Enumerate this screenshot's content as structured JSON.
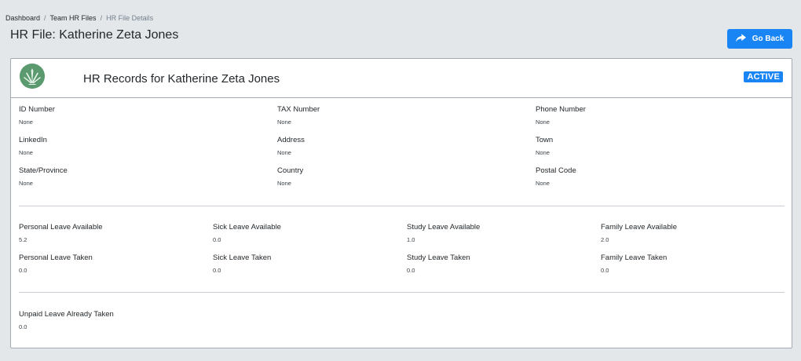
{
  "breadcrumb": {
    "items": [
      "Dashboard",
      "Team HR Files"
    ],
    "current": "HR File Details",
    "separator": "/"
  },
  "page_title": "HR File: Katherine Zeta Jones",
  "go_back_label": "Go Back",
  "card": {
    "title": "HR Records for Katherine Zeta Jones",
    "status": "ACTIVE",
    "colors": {
      "accent": "#1985f5",
      "logo_bg": "#5a9a6e"
    },
    "details": [
      {
        "label": "ID Number",
        "value": "None"
      },
      {
        "label": "TAX Number",
        "value": "None"
      },
      {
        "label": "Phone Number",
        "value": "None"
      },
      {
        "label": "LinkedIn",
        "value": "None"
      },
      {
        "label": "Address",
        "value": "None"
      },
      {
        "label": "Town",
        "value": "None"
      },
      {
        "label": "State/Province",
        "value": "None"
      },
      {
        "label": "Country",
        "value": "None"
      },
      {
        "label": "Postal Code",
        "value": "None"
      }
    ],
    "leave": [
      {
        "label": "Personal Leave Available",
        "value": "5.2"
      },
      {
        "label": "Sick Leave Available",
        "value": "0.0"
      },
      {
        "label": "Study Leave Available",
        "value": "1.0"
      },
      {
        "label": "Family Leave Available",
        "value": "2.0"
      },
      {
        "label": "Personal Leave Taken",
        "value": "0.0"
      },
      {
        "label": "Sick Leave Taken",
        "value": "0.0"
      },
      {
        "label": "Study Leave Taken",
        "value": "0.0"
      },
      {
        "label": "Family Leave Taken",
        "value": "0.0"
      }
    ],
    "unpaid": {
      "label": "Unpaid Leave Already Taken",
      "value": "0.0"
    }
  }
}
